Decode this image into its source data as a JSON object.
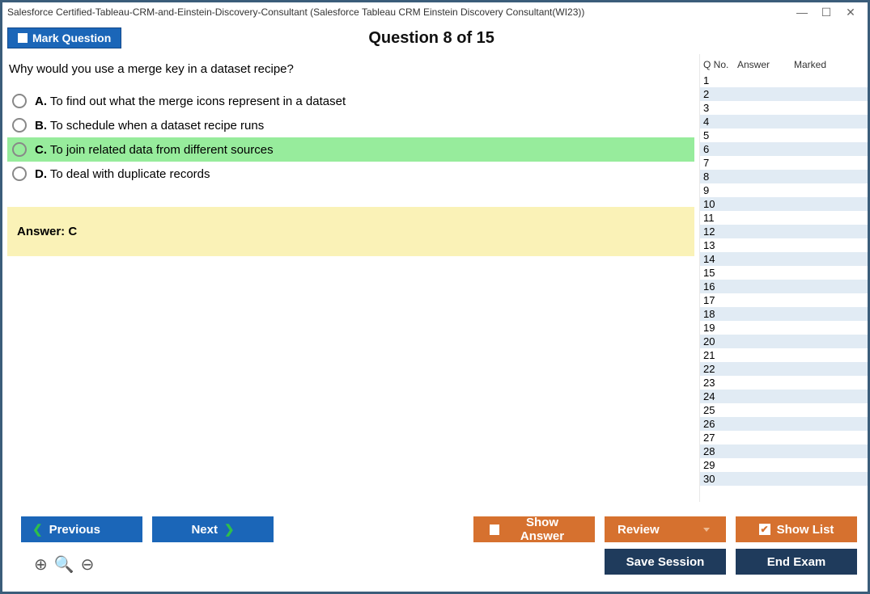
{
  "window": {
    "title": "Salesforce Certified-Tableau-CRM-and-Einstein-Discovery-Consultant (Salesforce Tableau CRM Einstein Discovery Consultant(WI23))"
  },
  "header": {
    "mark_label": "Mark Question",
    "question_title": "Question 8 of 15"
  },
  "question": {
    "text": "Why would you use a merge key in a dataset recipe?",
    "options": [
      {
        "letter": "A.",
        "text": "To find out what the merge icons represent in a dataset",
        "selected": false
      },
      {
        "letter": "B.",
        "text": "To schedule when a dataset recipe runs",
        "selected": false
      },
      {
        "letter": "C.",
        "text": "To join related data from different sources",
        "selected": true
      },
      {
        "letter": "D.",
        "text": "To deal with duplicate records",
        "selected": false
      }
    ],
    "answer_label": "Answer: C"
  },
  "side_table": {
    "headers": {
      "qno": "Q No.",
      "answer": "Answer",
      "marked": "Marked"
    },
    "rows": [
      1,
      2,
      3,
      4,
      5,
      6,
      7,
      8,
      9,
      10,
      11,
      12,
      13,
      14,
      15,
      16,
      17,
      18,
      19,
      20,
      21,
      22,
      23,
      24,
      25,
      26,
      27,
      28,
      29,
      30
    ]
  },
  "footer": {
    "previous": "Previous",
    "next": "Next",
    "show_answer": "Show Answer",
    "review": "Review",
    "show_list": "Show List",
    "save_session": "Save Session",
    "end_exam": "End Exam"
  }
}
